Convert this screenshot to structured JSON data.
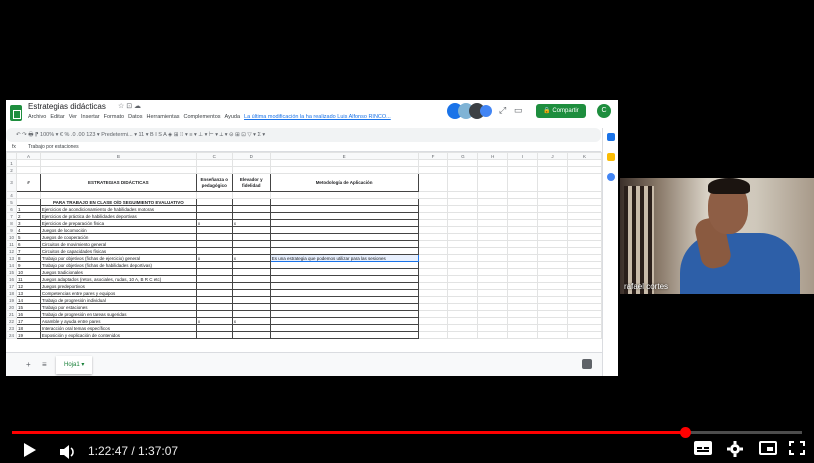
{
  "spreadsheet": {
    "title": "Estrategias didácticas",
    "title_icons": "☆ ⊡ ☁",
    "menu": [
      "Archivo",
      "Editar",
      "Ver",
      "Insertar",
      "Formato",
      "Datos",
      "Herramientas",
      "Complementos",
      "Ayuda"
    ],
    "last_edit": "La última modificación la ha realizado Luis Alfonso RINCO...",
    "share_label": "Compartir",
    "account_initial": "C",
    "toolbar_text": "↶ ↷ 🖶 ⁋  100% ▾  €  %  .0  .00  123 ▾  Predetermi... ▾  11  ▾  B  I  S  A  ◈  ⊞  ⁝⁝ ▾  ≡ ▾  ⊥ ▾  ⊢ ▾  ⟂ ▾  ⊝  ⊞  ⊡  ▽ ▾  Σ ▾",
    "formula_text": "Trabajo por estaciones",
    "columns": [
      "",
      "A",
      "B",
      "C",
      "D",
      "E",
      "F",
      "G",
      "H",
      "I",
      "J",
      "K"
    ],
    "table_headers": {
      "num": "#",
      "strategy": "ESTRATEGIAS DIDÁCTICAS",
      "c": "Enseñanza o pedagógico",
      "d": "Elevador y fidelidad",
      "e": "Metodología de Aplicación"
    },
    "section_title": "PARA TRABAJO EN CLASE O/D SEGUIMIENTO EVALUATIVO",
    "rows": [
      {
        "n": "1",
        "text": "Ejercicios de acondicionamiento de habilidades motoras",
        "c": "",
        "d": ""
      },
      {
        "n": "2",
        "text": "Ejercicios de práctica de habilidades deportivas",
        "c": "",
        "d": ""
      },
      {
        "n": "3",
        "text": "Ejercicios de preparación física",
        "c": "x",
        "d": "x"
      },
      {
        "n": "4",
        "text": "Juegos de locomoción",
        "c": "",
        "d": ""
      },
      {
        "n": "5",
        "text": "Juegos de cooperación",
        "c": "",
        "d": ""
      },
      {
        "n": "6",
        "text": "Circuitos de movimiento general",
        "c": "",
        "d": ""
      },
      {
        "n": "7",
        "text": "Circuitos de capacidades físicas",
        "c": "",
        "d": ""
      },
      {
        "n": "8",
        "text": "Trabajo por objetivos (fichas de ejercicio) general",
        "c": "x",
        "d": "x"
      },
      {
        "n": "9",
        "text": "Trabajo por objetivos (fichas de habilidades deportivas)",
        "c": "",
        "d": ""
      },
      {
        "n": "10",
        "text": "Juegos tradicionales",
        "c": "",
        "d": ""
      },
      {
        "n": "11",
        "text": "Juegos adaptados (retos, asociales, rudas, 10 A, B R C etc)",
        "c": "",
        "d": ""
      },
      {
        "n": "12",
        "text": "Juegos predeportivos",
        "c": "",
        "d": ""
      },
      {
        "n": "13",
        "text": "Competencias entre pares y equipos",
        "c": "",
        "d": ""
      },
      {
        "n": "14",
        "text": "Trabajo de progresión individual",
        "c": "",
        "d": ""
      },
      {
        "n": "15",
        "text": "Trabajo por estaciones",
        "c": "",
        "d": ""
      },
      {
        "n": "16",
        "text": "Trabajo de progresión en tareas sugeridas",
        "c": "",
        "d": ""
      },
      {
        "n": "17",
        "text": "Asamble y ayuda entre pares",
        "c": "x",
        "d": "x"
      },
      {
        "n": "18",
        "text": "Interacción oral temas específicos",
        "c": "",
        "d": ""
      },
      {
        "n": "19",
        "text": "Exposición y explicación de contenidos",
        "c": "",
        "d": ""
      }
    ],
    "selected_cell_text": "Es una estrategia que podemos utilizar para las sesiones",
    "sheet_tab": "Hoja1 ▾",
    "tab_add": "+",
    "tab_list": "≡"
  },
  "webcam": {
    "name": "rafael cortes"
  },
  "player": {
    "current_time": "1:22:47",
    "duration": "1:37:07",
    "time_label": "1:22:47 / 1:37:07",
    "progress": 0.852,
    "play_icon": "play-icon",
    "volume_icon": "volume-icon",
    "subtitles_icon": "subtitles-icon",
    "settings_icon": "settings-icon",
    "miniplayer_icon": "miniplayer-icon",
    "fullscreen_icon": "fullscreen-icon",
    "accent": "#ff0000"
  }
}
